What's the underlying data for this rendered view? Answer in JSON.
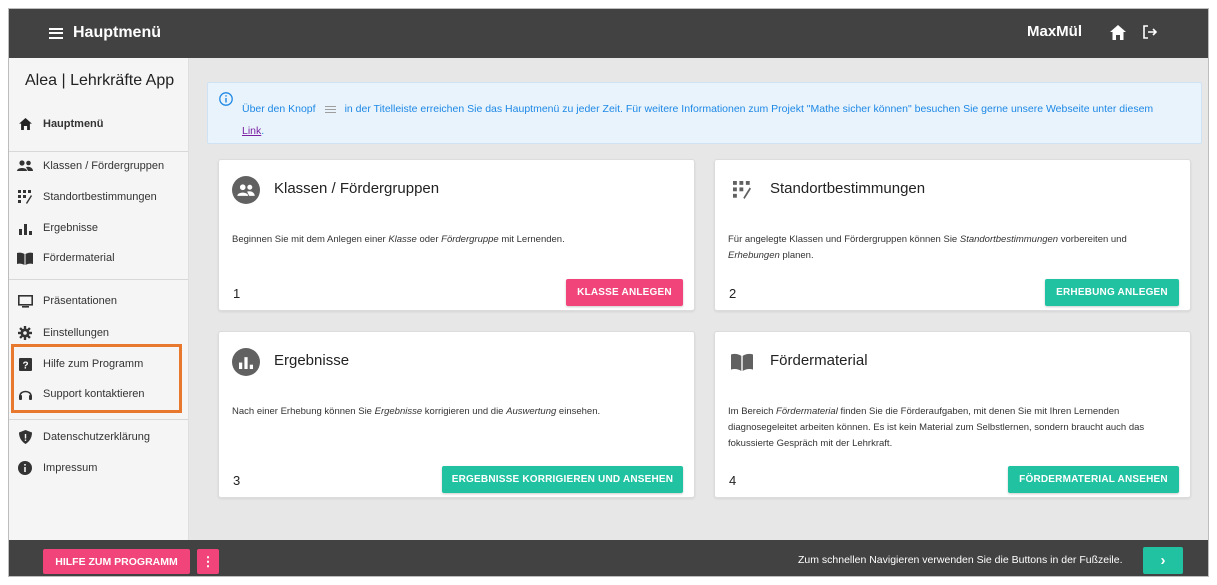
{
  "topbar": {
    "menu_label": "Hauptmenü",
    "username": "MaxMül",
    "icons": [
      "hamburger-icon",
      "home-icon",
      "logout-icon"
    ]
  },
  "sidebar": {
    "app_title": "Alea | Lehrkräfte App",
    "items": [
      {
        "label": "Hauptmenü",
        "icon": "home-icon"
      },
      {
        "label": "Klassen / Fördergruppen",
        "icon": "people-icon"
      },
      {
        "label": "Standortbestimmungen",
        "icon": "dialpad-icon"
      },
      {
        "label": "Ergebnisse",
        "icon": "bar-chart-icon"
      },
      {
        "label": "Fördermaterial",
        "icon": "book-icon"
      },
      {
        "label": "Präsentationen",
        "icon": "monitor-icon"
      },
      {
        "label": "Einstellungen",
        "icon": "gear-icon"
      },
      {
        "label": "Hilfe zum Programm",
        "icon": "help-icon"
      },
      {
        "label": "Support kontaktieren",
        "icon": "headset-icon"
      },
      {
        "label": "Datenschutzerklärung",
        "icon": "shield-icon"
      },
      {
        "label": "Impressum",
        "icon": "info-icon"
      }
    ],
    "highlight_color": "#e8782e"
  },
  "info": {
    "text_before": "Über den Knopf",
    "text_after": "in der Titelleiste erreichen Sie das Hauptmenü zu jeder Zeit. Für weitere Informationen zum Projekt \"Mathe sicher können\" besuchen Sie gerne unsere Webseite unter diesem",
    "link": "Link",
    "link_suffix": "."
  },
  "cards": [
    {
      "title": "Klassen / Fördergruppen",
      "desc_parts": [
        "Beginnen Sie mit dem Anlegen einer ",
        "Klasse",
        " oder ",
        "Fördergruppe",
        " mit Lernenden."
      ],
      "number": "1",
      "button": "KLASSE ANLEGEN",
      "icon": "people-icon"
    },
    {
      "title": "Standortbestimmungen",
      "desc_parts": [
        "Für angelegte Klassen und Fördergruppen können Sie ",
        "Standortbestimmungen",
        " vorbereiten und ",
        "Erhebungen",
        " planen."
      ],
      "number": "2",
      "button": "ERHEBUNG ANLEGEN",
      "icon": "dialpad-icon"
    },
    {
      "title": "Ergebnisse",
      "desc_parts": [
        "Nach einer Erhebung können Sie ",
        "Ergebnisse",
        " korrigieren und die ",
        "Auswertung",
        " einsehen."
      ],
      "number": "3",
      "button": "ERGEBNISSE KORRIGIEREN UND ANSEHEN",
      "icon": "bar-chart-icon"
    },
    {
      "title": "Fördermaterial",
      "desc_parts": [
        "Im Bereich ",
        "Fördermaterial",
        " finden Sie die Förderaufgaben, mit denen Sie mit Ihren Lernenden diagnosegeleitet arbeiten können. Es ist kein Material zum Selbstlernen, sondern braucht auch das fokussierte Gespräch mit der Lehrkraft.",
        "",
        ""
      ],
      "number": "4",
      "button": "FÖRDERMATERIAL ANSEHEN",
      "icon": "book-icon"
    }
  ],
  "footer": {
    "help_button": "HILFE ZUM PROGRAMM",
    "more_button": "⋮",
    "hint": "Zum schnellen Navigieren verwenden Sie die Buttons in der Fußzeile.",
    "next_button": "›"
  },
  "colors": {
    "pink": "#f0447a",
    "teal": "#21c2a2",
    "dark": "#424242",
    "info_bg": "#e8f3fc",
    "info_text": "#1e88e5"
  }
}
